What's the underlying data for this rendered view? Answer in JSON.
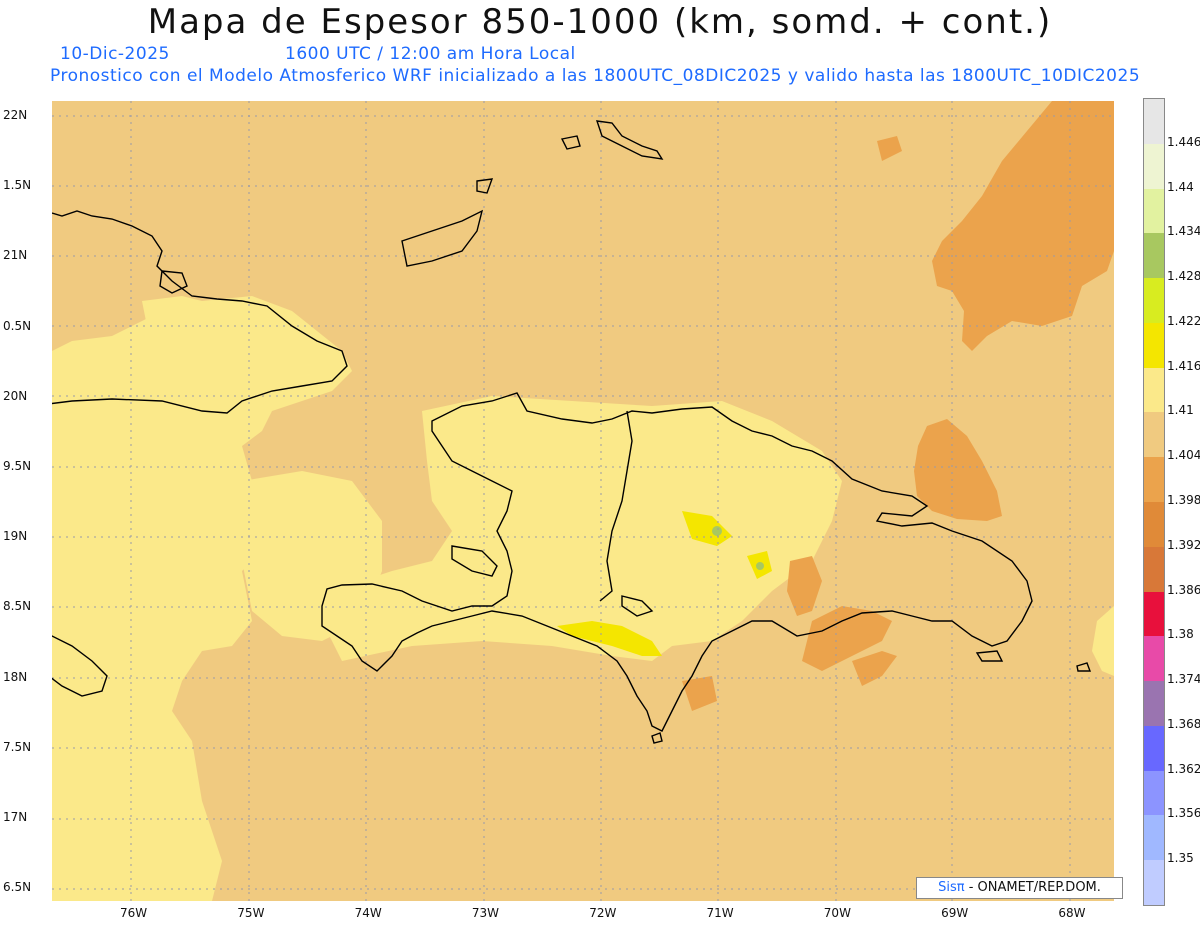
{
  "header": {
    "title": "Mapa de Espesor 850-1000 (km, somd. + cont.)",
    "date": "10-Dic-2025",
    "time": "1600 UTC / 12:00 am Hora Local",
    "model_note": "Pronostico con el Modelo Atmosferico WRF inicializado a las 1800UTC_08DIC2025 y valido hasta las  1800UTC_10DIC2025"
  },
  "axes": {
    "lat_labels": [
      "22N",
      "1.5N",
      "21N",
      "0.5N",
      "20N",
      "9.5N",
      "19N",
      "8.5N",
      "18N",
      "7.5N",
      "17N",
      "6.5N"
    ],
    "lon_labels": [
      "76W",
      "75W",
      "74W",
      "73W",
      "72W",
      "71W",
      "70W",
      "69W",
      "68W"
    ]
  },
  "colorbar": {
    "labels": [
      "1.446",
      "1.44",
      "1.434",
      "1.428",
      "1.422",
      "1.416",
      "1.41",
      "1.404",
      "1.398",
      "1.392",
      "1.386",
      "1.38",
      "1.374",
      "1.368",
      "1.362",
      "1.356",
      "1.35"
    ],
    "colors": [
      "#e6e6e6",
      "#eef4d2",
      "#e2f2a0",
      "#a8c860",
      "#d8ec20",
      "#f4e600",
      "#fbe98a",
      "#f0ca80",
      "#eba34c",
      "#e08a38",
      "#d87838",
      "#e8103c",
      "#e84aa8",
      "#9a74b0",
      "#6868ff",
      "#8c94ff",
      "#a0b8ff",
      "#c0ccff"
    ]
  },
  "credit": {
    "brand": "Sisπ",
    "text": "- ONAMET/REP.DOM."
  },
  "map_colors": {
    "base": "#f0ca80",
    "light": "#fbe98a",
    "warm": "#eba34c",
    "bright": "#f4e600",
    "coast": "#000000"
  }
}
